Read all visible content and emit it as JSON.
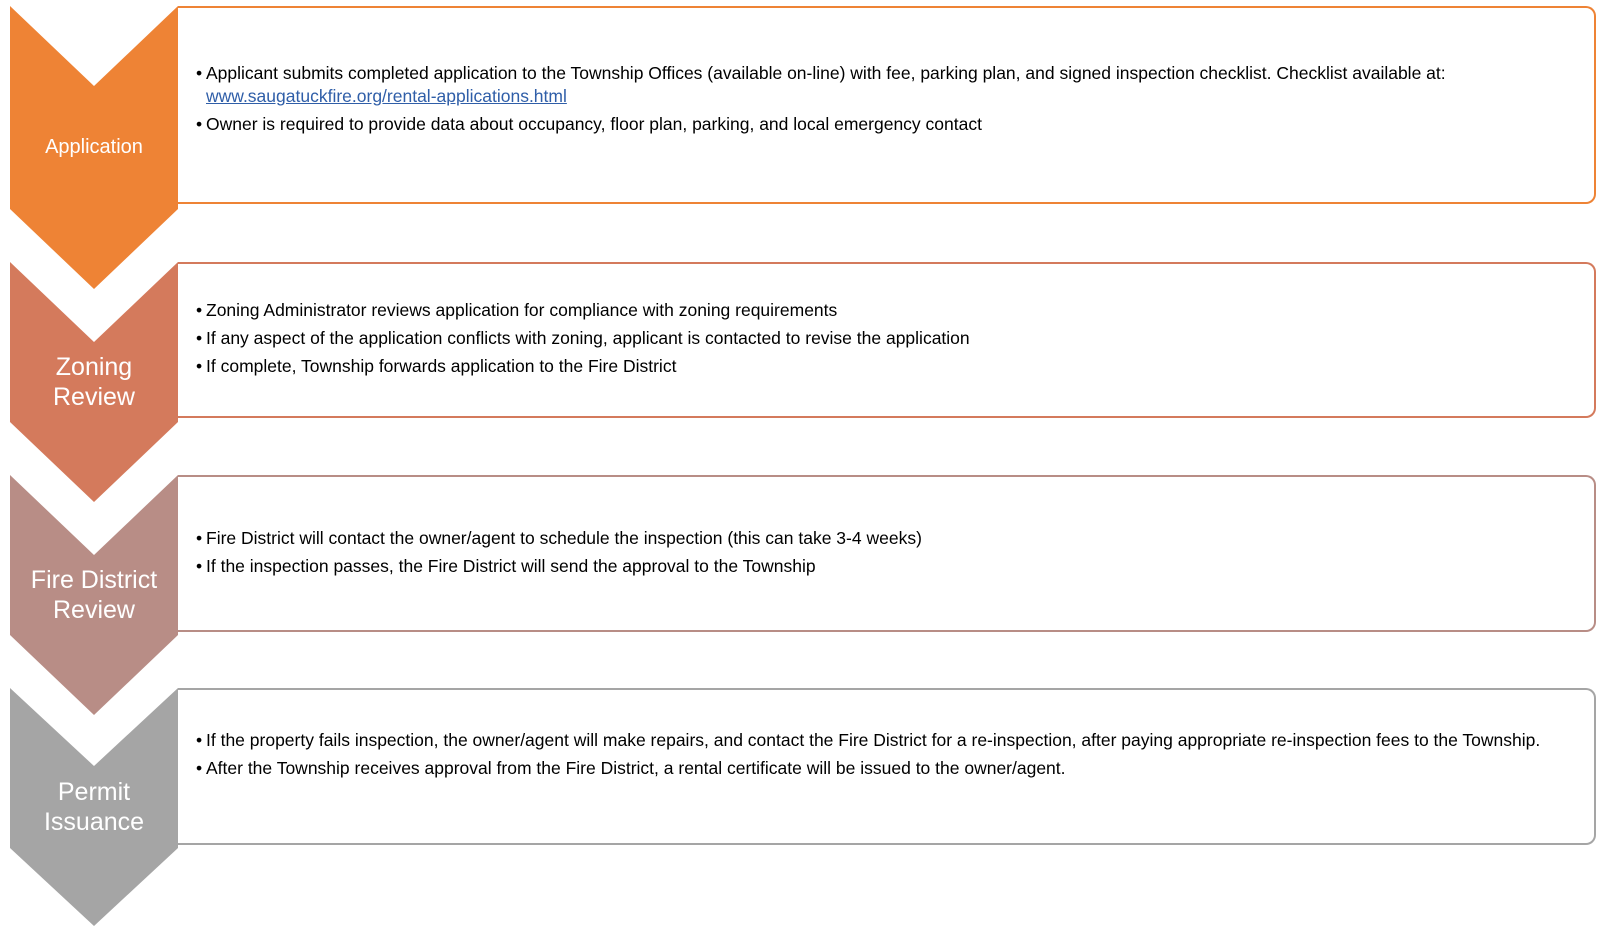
{
  "steps": [
    {
      "label": "Application",
      "color": "#ee8335",
      "bullets": [
        {
          "text": "Applicant submits completed application to the Township Offices (available on-line) with fee, parking plan, and signed inspection checklist. Checklist available at: ",
          "link": "www.saugatuckfire.org/rental-applications.html"
        },
        {
          "text": "Owner is required to provide data about occupancy, floor plan, parking, and local emergency contact"
        }
      ]
    },
    {
      "label": "Zoning Review",
      "color": "#d47a5c",
      "bullets": [
        {
          "text": "Zoning Administrator reviews application for compliance with zoning requirements"
        },
        {
          "text": "If any aspect of the application conflicts with zoning, applicant is contacted to revise the application"
        },
        {
          "text": "If complete, Township forwards application to the Fire District"
        }
      ]
    },
    {
      "label": "Fire District Review",
      "color": "#b88d86",
      "bullets": [
        {
          "text": "Fire District will contact the owner/agent to schedule the inspection (this can take 3-4 weeks)"
        },
        {
          "text": "If the inspection passes, the Fire District will send the approval to the Township"
        }
      ]
    },
    {
      "label": "Permit Issuance",
      "color": "#a5a5a5",
      "bullets": [
        {
          "text": "If the property fails inspection, the owner/agent will make repairs, and contact the Fire District for a re-inspection, after paying appropriate re-inspection fees to the Township."
        },
        {
          "text": "After the Township receives approval from the Fire District, a rental certificate will be issued to the owner/agent."
        }
      ]
    }
  ]
}
